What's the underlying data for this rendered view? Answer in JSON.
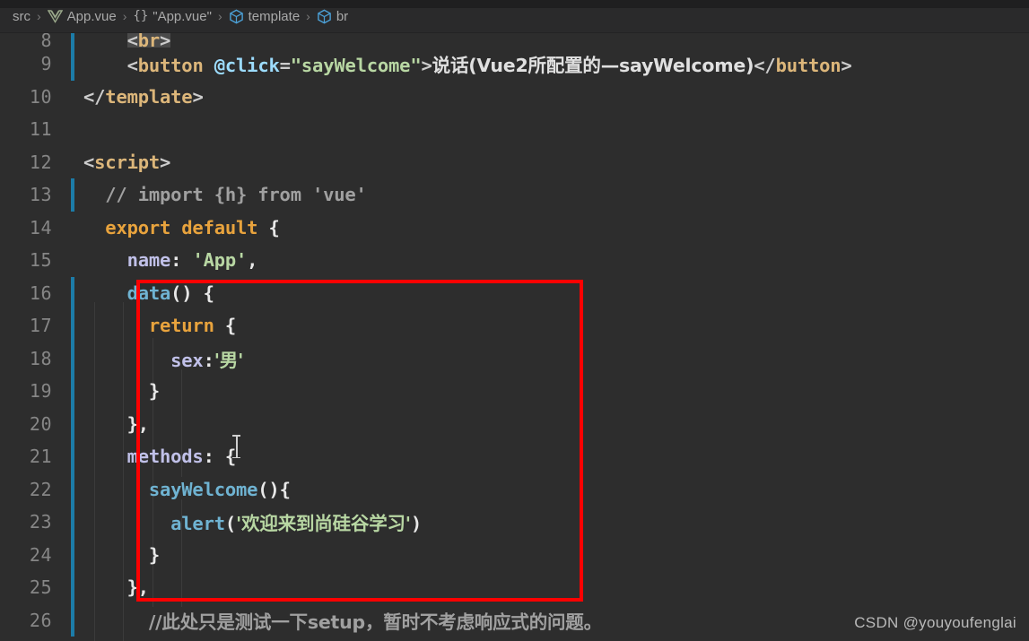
{
  "window": {
    "theme_background": "#2d2d2d",
    "gutter_text_color": "#868686",
    "annotation_color": "#fe0000",
    "git_change_color": "#1c7ca8"
  },
  "breadcrumb": {
    "name": "breadcrumb",
    "items": [
      {
        "label": "src",
        "icon": ""
      },
      {
        "label": "App.vue",
        "icon": "vue-logo-icon"
      },
      {
        "label": "\"App.vue\"",
        "icon": "braces-icon"
      },
      {
        "label": "template",
        "icon": "cube-icon"
      },
      {
        "label": "br",
        "icon": "cube-icon"
      }
    ],
    "separator": "›"
  },
  "editor": {
    "language": "vue",
    "first_visible_line": 8,
    "last_visible_line": 26,
    "lines": [
      {
        "number": "8",
        "clipped": true,
        "git_changed": true,
        "tokens": [
          {
            "t": "    ",
            "c": "t-plain"
          },
          {
            "t": "<",
            "c": "t-punct sel-box"
          },
          {
            "t": "br",
            "c": "t-tag sel-box"
          },
          {
            "t": ">",
            "c": "t-punct sel-box"
          }
        ]
      },
      {
        "number": "9",
        "git_changed": true,
        "tokens": [
          {
            "t": "    ",
            "c": "t-plain"
          },
          {
            "t": "<",
            "c": "t-punct"
          },
          {
            "t": "button",
            "c": "t-tag"
          },
          {
            "t": " ",
            "c": "t-plain"
          },
          {
            "t": "@click",
            "c": "t-attr"
          },
          {
            "t": "=",
            "c": "t-punct"
          },
          {
            "t": "\"sayWelcome\"",
            "c": "t-string"
          },
          {
            "t": ">",
            "c": "t-punct"
          },
          {
            "t": "说话(Vue2所配置的—sayWelcome)",
            "c": "t-cjk"
          },
          {
            "t": "</",
            "c": "t-punct"
          },
          {
            "t": "button",
            "c": "t-tag"
          },
          {
            "t": ">",
            "c": "t-punct"
          }
        ]
      },
      {
        "number": "10",
        "git_changed": false,
        "tokens": [
          {
            "t": "</",
            "c": "t-punct"
          },
          {
            "t": "template",
            "c": "t-tag"
          },
          {
            "t": ">",
            "c": "t-punct"
          }
        ]
      },
      {
        "number": "11",
        "git_changed": false,
        "tokens": []
      },
      {
        "number": "12",
        "git_changed": false,
        "tokens": [
          {
            "t": "<",
            "c": "t-punct"
          },
          {
            "t": "script",
            "c": "t-tag"
          },
          {
            "t": ">",
            "c": "t-punct"
          }
        ]
      },
      {
        "number": "13",
        "git_changed": true,
        "tokens": [
          {
            "t": "  // import {h} from 'vue'",
            "c": "t-comment"
          }
        ]
      },
      {
        "number": "14",
        "git_changed": false,
        "tokens": [
          {
            "t": "  ",
            "c": "t-plain"
          },
          {
            "t": "export default",
            "c": "t-keyword"
          },
          {
            "t": " {",
            "c": "t-plain"
          }
        ]
      },
      {
        "number": "15",
        "git_changed": false,
        "tokens": [
          {
            "t": "    ",
            "c": "t-plain"
          },
          {
            "t": "name",
            "c": "t-prop"
          },
          {
            "t": ": ",
            "c": "t-plain"
          },
          {
            "t": "'App'",
            "c": "t-string"
          },
          {
            "t": ",",
            "c": "t-plain"
          }
        ]
      },
      {
        "number": "16",
        "git_changed": true,
        "tokens": [
          {
            "t": "    ",
            "c": "t-plain"
          },
          {
            "t": "data",
            "c": "t-func"
          },
          {
            "t": "() {",
            "c": "t-plain"
          }
        ]
      },
      {
        "number": "17",
        "git_changed": true,
        "tokens": [
          {
            "t": "      ",
            "c": "t-plain"
          },
          {
            "t": "return",
            "c": "t-keyword"
          },
          {
            "t": " {",
            "c": "t-plain"
          }
        ]
      },
      {
        "number": "18",
        "git_changed": true,
        "tokens": [
          {
            "t": "        ",
            "c": "t-plain"
          },
          {
            "t": "sex",
            "c": "t-prop"
          },
          {
            "t": ":",
            "c": "t-plain"
          },
          {
            "t": "'男'",
            "c": "t-cjkstr"
          }
        ]
      },
      {
        "number": "19",
        "git_changed": true,
        "tokens": [
          {
            "t": "      }",
            "c": "t-plain"
          }
        ]
      },
      {
        "number": "20",
        "git_changed": true,
        "tokens": [
          {
            "t": "    },",
            "c": "t-plain"
          }
        ]
      },
      {
        "number": "21",
        "git_changed": true,
        "tokens": [
          {
            "t": "    ",
            "c": "t-plain"
          },
          {
            "t": "methods",
            "c": "t-prop"
          },
          {
            "t": ": {",
            "c": "t-plain"
          }
        ]
      },
      {
        "number": "22",
        "git_changed": true,
        "tokens": [
          {
            "t": "      ",
            "c": "t-plain"
          },
          {
            "t": "sayWelcome",
            "c": "t-func"
          },
          {
            "t": "(){",
            "c": "t-plain"
          }
        ]
      },
      {
        "number": "23",
        "git_changed": true,
        "tokens": [
          {
            "t": "        ",
            "c": "t-plain"
          },
          {
            "t": "alert",
            "c": "t-func"
          },
          {
            "t": "(",
            "c": "t-plain"
          },
          {
            "t": "'欢迎来到尚硅谷学习'",
            "c": "t-cjkstr"
          },
          {
            "t": ")",
            "c": "t-plain"
          }
        ]
      },
      {
        "number": "24",
        "git_changed": true,
        "tokens": [
          {
            "t": "      }",
            "c": "t-plain"
          }
        ]
      },
      {
        "number": "25",
        "git_changed": true,
        "tokens": [
          {
            "t": "    },",
            "c": "t-plain"
          }
        ]
      },
      {
        "number": "26",
        "git_changed": true,
        "tokens": [
          {
            "t": "      ",
            "c": "t-plain"
          },
          {
            "t": "//此处只是测试一下setup，暂时不考虑响应式的问题。",
            "c": "t-cjkcmt"
          }
        ]
      }
    ]
  },
  "annotation": {
    "type": "rectangle-highlight",
    "color": "#fe0000",
    "covers_lines": "16-25"
  },
  "watermark": {
    "text": "CSDN @youyoufenglai"
  }
}
